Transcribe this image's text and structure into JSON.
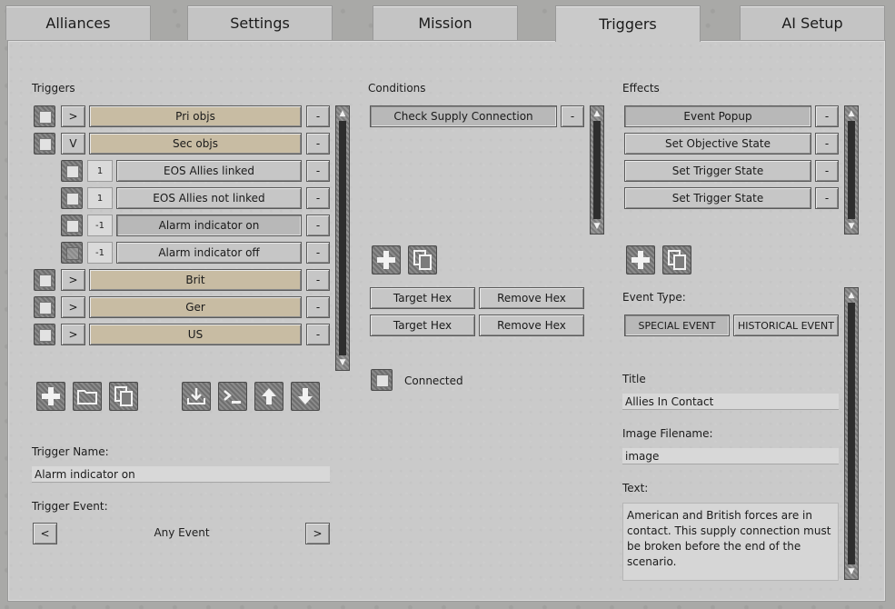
{
  "tabs": [
    "Alliances",
    "Settings",
    "Mission",
    "Triggers",
    "AI Setup"
  ],
  "active_tab": "Triggers",
  "triggers": {
    "header": "Triggers",
    "rows": [
      {
        "expand": ">",
        "label": "Pri objs",
        "remove": "-"
      },
      {
        "expand": "V",
        "label": "Sec objs",
        "remove": "-"
      },
      {
        "num": "1",
        "label": "EOS Allies linked",
        "remove": "-"
      },
      {
        "num": "1",
        "label": "EOS Allies not linked",
        "remove": "-"
      },
      {
        "num": "-1",
        "label": "Alarm indicator on",
        "remove": "-"
      },
      {
        "num": "-1",
        "label": "Alarm indicator off",
        "remove": "-"
      },
      {
        "expand": ">",
        "label": "Brit",
        "remove": "-"
      },
      {
        "expand": ">",
        "label": "Ger",
        "remove": "-"
      },
      {
        "expand": ">",
        "label": "US",
        "remove": "-"
      }
    ],
    "name_label": "Trigger Name:",
    "name_value": "Alarm indicator on",
    "event_label": "Trigger Event:",
    "event_prev": "<",
    "event_value": "Any Event",
    "event_next": ">"
  },
  "conditions": {
    "header": "Conditions",
    "items": [
      {
        "label": "Check Supply Connection",
        "remove": "-"
      }
    ],
    "target_hex_1": "Target Hex",
    "remove_hex_1": "Remove Hex",
    "target_hex_2": "Target Hex",
    "remove_hex_2": "Remove Hex",
    "connected_label": "Connected"
  },
  "effects": {
    "header": "Effects",
    "items": [
      {
        "label": "Event Popup",
        "remove": "-"
      },
      {
        "label": "Set Objective State",
        "remove": "-"
      },
      {
        "label": "Set Trigger State",
        "remove": "-"
      },
      {
        "label": "Set Trigger State",
        "remove": "-"
      }
    ],
    "event_type_label": "Event Type:",
    "special_event": "SPECIAL EVENT",
    "historical_event": "HISTORICAL EVENT",
    "title_label": "Title",
    "title_value": "Allies In Contact",
    "image_label": "Image Filename:",
    "image_value": "image",
    "text_label": "Text:",
    "text_value": "American and British forces are in contact. This supply connection must be broken before the end of the scenario."
  },
  "scroll_arrows": {
    "up": "▲",
    "down": "▼"
  }
}
